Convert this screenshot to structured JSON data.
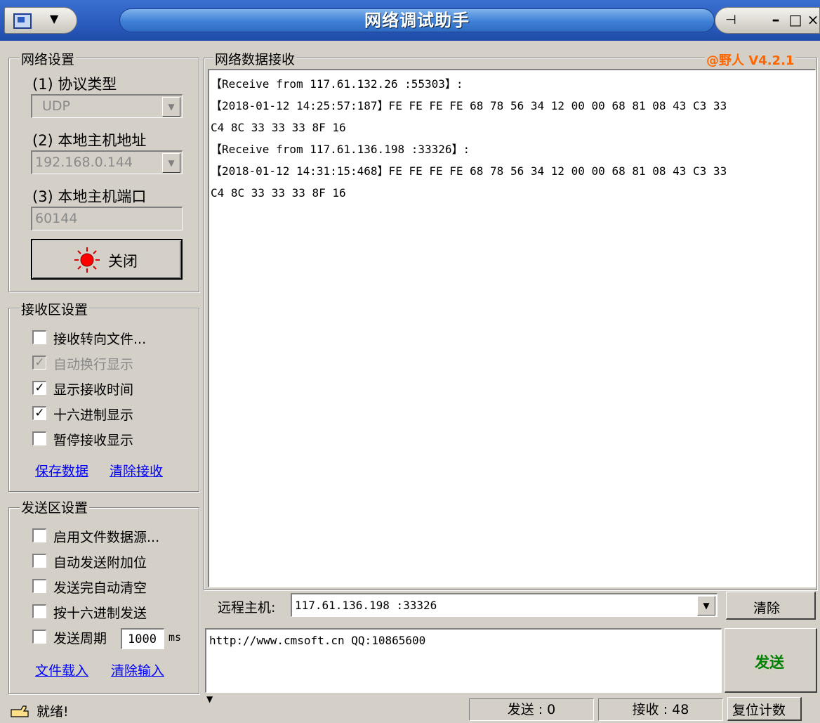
{
  "window": {
    "title": "网络调试助手",
    "version": "@野人 V4.2.1"
  },
  "network": {
    "group_label": "网络设置",
    "protocol_label": "(1) 协议类型",
    "protocol_value": "UDP",
    "host_label": "(2) 本地主机地址",
    "host_value": "192.168.0.144",
    "port_label": "(3) 本地主机端口",
    "port_value": "60144",
    "close_button": "关闭"
  },
  "receive_settings": {
    "group_label": "接收区设置",
    "options": [
      {
        "label": "接收转向文件...",
        "checked": false,
        "disabled": false
      },
      {
        "label": "自动换行显示",
        "checked": true,
        "disabled": true
      },
      {
        "label": "显示接收时间",
        "checked": true,
        "disabled": false
      },
      {
        "label": "十六进制显示",
        "checked": true,
        "disabled": false
      },
      {
        "label": "暂停接收显示",
        "checked": false,
        "disabled": false
      }
    ],
    "save_link": "保存数据",
    "clear_link": "清除接收"
  },
  "send_settings": {
    "group_label": "发送区设置",
    "options": [
      {
        "label": "启用文件数据源...",
        "checked": false
      },
      {
        "label": "自动发送附加位",
        "checked": false
      },
      {
        "label": "发送完自动清空",
        "checked": false
      },
      {
        "label": "按十六进制发送",
        "checked": false
      },
      {
        "label": "发送周期",
        "checked": false
      }
    ],
    "period_value": "1000",
    "period_unit": "ms",
    "load_link": "文件载入",
    "clear_link": "清除输入"
  },
  "receive_area": {
    "label": "网络数据接收",
    "lines": [
      "【Receive from 117.61.132.26 :55303】:",
      "【2018-01-12 14:25:57:187】FE FE FE FE 68 78 56 34 12 00 00 68 81 08 43 C3 33",
      "C4 8C 33 33 33 8F 16",
      "【Receive from 117.61.136.198 :33326】:",
      "【2018-01-12 14:31:15:468】FE FE FE FE 68 78 56 34 12 00 00 68 81 08 43 C3 33",
      "C4 8C 33 33 33 8F 16"
    ]
  },
  "remote": {
    "label": "远程主机:",
    "value": "117.61.136.198 :33326",
    "clear_button": "清除"
  },
  "send_area": {
    "text": "http://www.cmsoft.cn QQ:10865600",
    "send_button": "发送"
  },
  "statusbar": {
    "ready": "就绪!",
    "sent": "发送 : 0",
    "received": "接收 : 48",
    "reset_button": "复位计数"
  },
  "colors": {
    "titlebar": "#2a5bbd",
    "version": "#ff6600",
    "send_button": "#008000",
    "link": "#0000ff"
  }
}
